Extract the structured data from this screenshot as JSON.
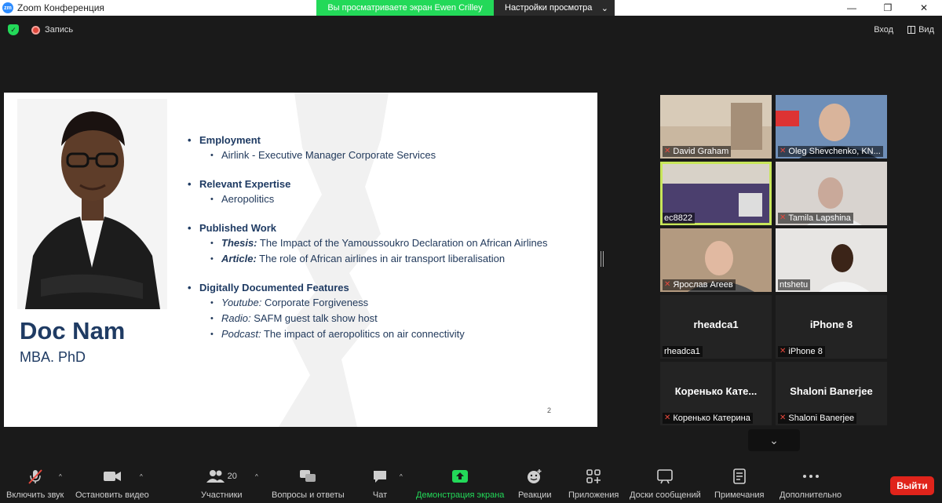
{
  "window": {
    "app_title": "Zoom Конференция",
    "logo_text": "zm",
    "minimize": "—",
    "maximize": "❐",
    "close": "✕"
  },
  "share_banner": {
    "viewing_text": "Вы просматриваете экран Ewen Crilley",
    "settings_label": "Настройки просмотра",
    "caret": "⌄"
  },
  "topbar": {
    "recording_label": "Запись",
    "exit_label": "Вход",
    "view_label": "Вид"
  },
  "slide": {
    "name": "Doc Nam",
    "degree": "MBA. PhD",
    "page_number": "2",
    "sections": [
      {
        "title": "Employment",
        "items": [
          {
            "prefix": "",
            "text": "Airlink - Executive Manager Corporate Services"
          }
        ]
      },
      {
        "title": "Relevant Expertise",
        "items": [
          {
            "prefix": "",
            "text": "Aeropolitics"
          }
        ]
      },
      {
        "title": "Published Work",
        "items": [
          {
            "prefix": "Thesis:",
            "prefix_style": "bold-italic",
            "text": " The Impact of the Yamoussoukro Declaration on African Airlines"
          },
          {
            "prefix": "Article:",
            "prefix_style": "bold-italic",
            "text": " The role of African airlines in air transport liberalisation"
          }
        ]
      },
      {
        "title": "Digitally Documented Features",
        "items": [
          {
            "prefix": "Youtube:",
            "prefix_style": "italic",
            "text": " Corporate Forgiveness"
          },
          {
            "prefix": "Radio:",
            "prefix_style": "italic",
            "text": " SAFM  guest talk show host"
          },
          {
            "prefix": "Podcast:",
            "prefix_style": "italic",
            "text": " The impact of aeropolitics on air connectivity"
          }
        ]
      }
    ]
  },
  "participants_tiles": [
    {
      "name": "David Graham",
      "muted": true,
      "video": true,
      "bg": "#c9b7a0"
    },
    {
      "name": "Oleg Shevchenko, KN...",
      "muted": true,
      "video": true,
      "bg": "#6f8fb8"
    },
    {
      "name": "ec8822",
      "muted": false,
      "video": true,
      "bg": "#5a4f7a",
      "active": true
    },
    {
      "name": "Tamila Lapshina",
      "muted": true,
      "video": true,
      "bg": "#d8d3cf"
    },
    {
      "name": "Ярослав Агеев",
      "muted": true,
      "video": true,
      "bg": "#b39a80"
    },
    {
      "name": "ntshetu",
      "muted": false,
      "video": true,
      "bg": "#e7e5e3"
    },
    {
      "name": "rheadca1",
      "muted": false,
      "video": false,
      "big": "rheadca1"
    },
    {
      "name": "iPhone 8",
      "muted": true,
      "video": false,
      "big": "iPhone 8"
    },
    {
      "name": "Коренько Катерина",
      "muted": true,
      "video": false,
      "big": "Коренько  Кате..."
    },
    {
      "name": "Shaloni Banerjee",
      "muted": true,
      "video": false,
      "big": "Shaloni Banerjee"
    }
  ],
  "toolbar": {
    "mute_label": "Включить звук",
    "video_label": "Остановить видео",
    "participants_label": "Участники",
    "participants_count": "20",
    "qa_label": "Вопросы и ответы",
    "chat_label": "Чат",
    "share_label": "Демонстрация экрана",
    "reactions_label": "Реакции",
    "apps_label": "Приложения",
    "whiteboards_label": "Доски сообщений",
    "notes_label": "Примечания",
    "more_label": "Дополнительно",
    "leave_label": "Выйти",
    "caret": "^"
  },
  "colors": {
    "accent_green": "#23d959",
    "leave_red": "#e0241b",
    "slide_navy": "#1f3b63",
    "active_speaker": "#c8e65a"
  }
}
